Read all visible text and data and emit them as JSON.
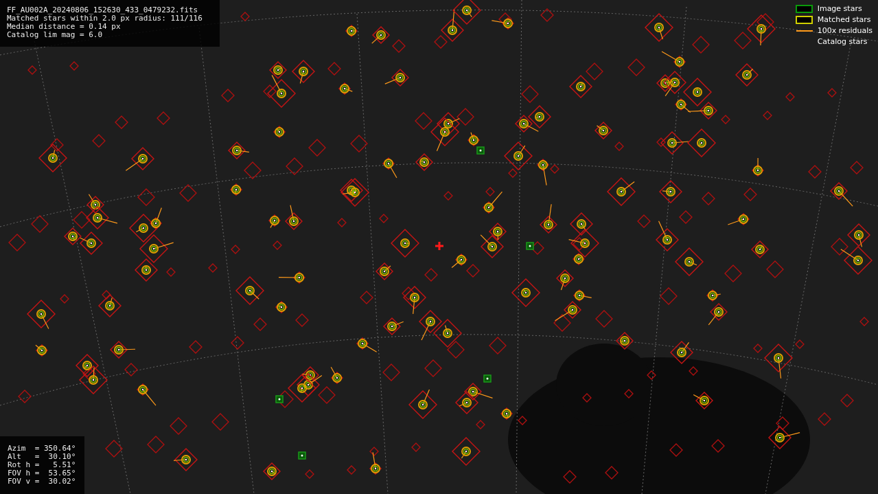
{
  "file_info": {
    "lines": [
      "FF_AU002A_20240806_152630_433_0479232.fits",
      "Matched stars within 2.0 px radius: 111/116",
      "Median distance = 0.14 px",
      "Catalog lim mag = 6.0"
    ]
  },
  "legend": {
    "items": [
      {
        "label": "Image stars",
        "kind": "image"
      },
      {
        "label": "Matched stars",
        "kind": "matched"
      },
      {
        "label": "100x residuals",
        "kind": "residual"
      },
      {
        "label": "Catalog stars",
        "kind": "catalog"
      }
    ]
  },
  "pointing": {
    "lines": [
      "Azim  = 350.64°",
      "Alt   =  30.10°",
      "Rot h =   5.51°",
      "FOV h =  53.65°",
      "FOV v =  30.02°"
    ]
  }
}
